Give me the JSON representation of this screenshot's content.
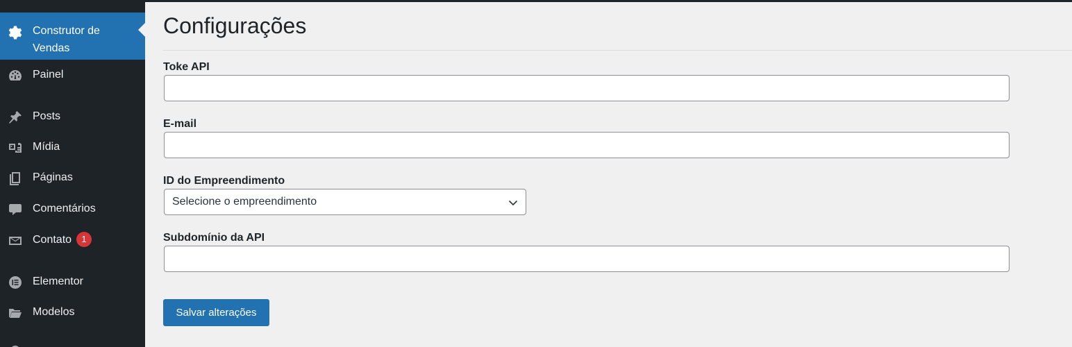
{
  "sidebar": {
    "items": [
      {
        "label": "Construtor de Vendas",
        "icon": "gear-icon",
        "active": true
      },
      {
        "label": "Painel",
        "icon": "dashboard-icon"
      },
      {
        "label": "Posts",
        "icon": "pin-icon"
      },
      {
        "label": "Mídia",
        "icon": "media-icon"
      },
      {
        "label": "Páginas",
        "icon": "pages-icon"
      },
      {
        "label": "Comentários",
        "icon": "comment-icon"
      },
      {
        "label": "Contato",
        "icon": "mail-icon",
        "badge": "1"
      },
      {
        "label": "Elementor",
        "icon": "elementor-icon"
      },
      {
        "label": "Modelos",
        "icon": "folder-icon"
      }
    ]
  },
  "main": {
    "title": "Configurações",
    "fields": {
      "token": {
        "label": "Toke API",
        "value": ""
      },
      "email": {
        "label": "E-mail",
        "value": ""
      },
      "empreendimento": {
        "label": "ID do Empreendimento",
        "selected": "Selecione o empreendimento"
      },
      "subdominio": {
        "label": "Subdomínio da API",
        "value": ""
      }
    },
    "save_label": "Salvar alterações"
  },
  "colors": {
    "sidebar_bg": "#1d2327",
    "accent": "#2271b1",
    "badge": "#d63638",
    "page_bg": "#f0f0f1"
  }
}
